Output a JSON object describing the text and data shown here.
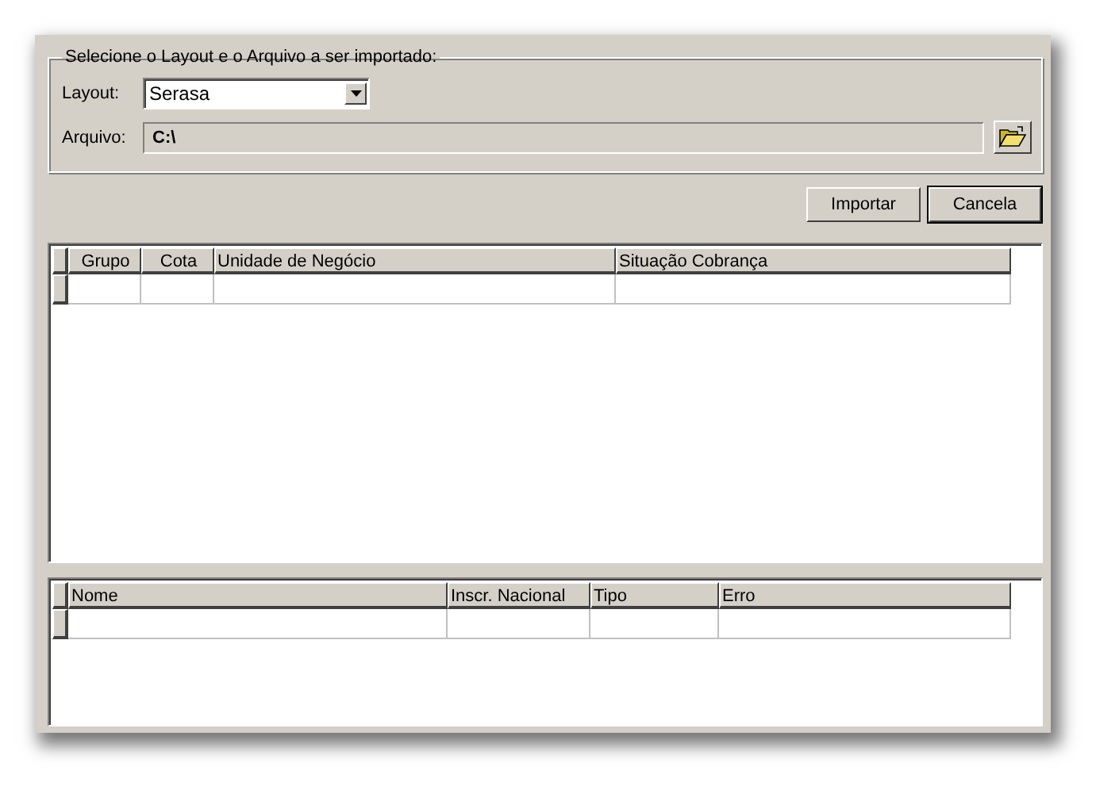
{
  "group_title": "Selecione o Layout e o Arquivo a ser importado:",
  "layout": {
    "label": "Layout:",
    "value": "Serasa"
  },
  "arquivo": {
    "label": "Arquivo:",
    "value": "C:\\"
  },
  "buttons": [
    {
      "label": "Importar",
      "default": false
    },
    {
      "label": "Cancela",
      "default": true
    }
  ],
  "grids": [
    {
      "columns": [
        "Grupo",
        "Cota",
        "Unidade de Negócio",
        "Situação Cobrança"
      ]
    },
    {
      "columns": [
        "Nome",
        "Inscr. Nacional",
        "Tipo",
        "Erro"
      ]
    }
  ]
}
